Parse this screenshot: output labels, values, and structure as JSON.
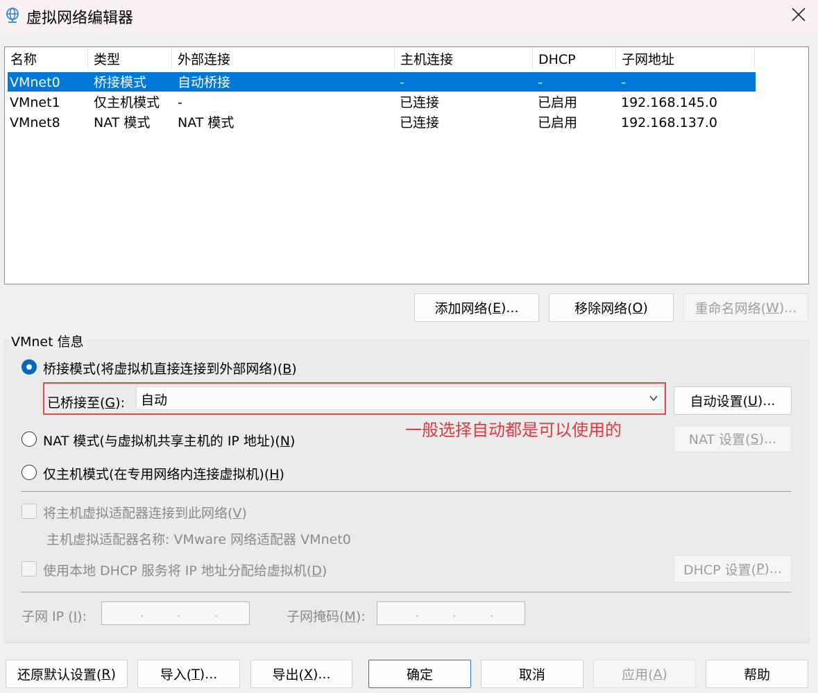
{
  "window": {
    "title": "虚拟网络编辑器"
  },
  "list": {
    "columns": [
      "名称",
      "类型",
      "外部连接",
      "主机连接",
      "DHCP",
      "子网地址"
    ],
    "rows": [
      {
        "name": "VMnet0",
        "type": "桥接模式",
        "external": "自动桥接",
        "host": "-",
        "dhcp": "-",
        "subnet": "-"
      },
      {
        "name": "VMnet1",
        "type": "仅主机模式",
        "external": "-",
        "host": "已连接",
        "dhcp": "已启用",
        "subnet": "192.168.145.0"
      },
      {
        "name": "VMnet8",
        "type": "NAT 模式",
        "external": "NAT 模式",
        "host": "已连接",
        "dhcp": "已启用",
        "subnet": "192.168.137.0"
      }
    ]
  },
  "list_buttons": {
    "add": {
      "pre": "添加网络(",
      "key": "E",
      "post": ")..."
    },
    "remove": {
      "pre": "移除网络(",
      "key": "O",
      "post": ")"
    },
    "rename": {
      "pre": "重命名网络(",
      "key": "W",
      "post": ")..."
    }
  },
  "vmnet_info": {
    "legend": "VMnet 信息",
    "bridged": {
      "pre": "桥接模式(将虚拟机直接连接到外部网络)(",
      "key": "B",
      "post": ")"
    },
    "bridged_to": {
      "pre": "已桥接至(",
      "key": "G",
      "post": "):"
    },
    "bridged_to_value": "自动",
    "auto_settings": {
      "pre": "自动设置(",
      "key": "U",
      "post": ")..."
    },
    "annotation": "一般选择自动都是可以使用的",
    "nat": {
      "pre": "NAT 模式(与虚拟机共享主机的 IP 地址)(",
      "key": "N",
      "post": ")"
    },
    "nat_settings": {
      "pre": "NAT 设置(",
      "key": "S",
      "post": ")..."
    },
    "host_only": {
      "pre": "仅主机模式(在专用网络内连接虚拟机)(",
      "key": "H",
      "post": ")"
    },
    "connect_adapter": {
      "pre": "将主机虚拟适配器连接到此网络(",
      "key": "V",
      "post": ")"
    },
    "adapter_name": "主机虚拟适配器名称: VMware 网络适配器 VMnet0",
    "use_dhcp": {
      "pre": "使用本地 DHCP 服务将 IP 地址分配给虚拟机(",
      "key": "D",
      "post": ")"
    },
    "dhcp_settings": {
      "pre": "DHCP 设置(",
      "key": "P",
      "post": ")..."
    },
    "subnet_ip": {
      "pre": "子网 IP (",
      "key": "I",
      "post": "):"
    },
    "subnet_mask": {
      "pre": "子网掩码(",
      "key": "M",
      "post": "):"
    }
  },
  "footer": {
    "restore": {
      "pre": "还原默认设置(",
      "key": "R",
      "post": ")"
    },
    "import": {
      "pre": "导入(",
      "key": "T",
      "post": ")..."
    },
    "export": {
      "pre": "导出(",
      "key": "X",
      "post": ")..."
    },
    "ok": "确定",
    "cancel": "取消",
    "apply": {
      "pre": "应用(",
      "key": "A",
      "post": ")"
    },
    "help": "帮助"
  },
  "icons": [
    "network-globe-icon",
    "close-icon",
    "chevron-down-icon"
  ],
  "colors": {
    "selection": "#0078d7",
    "annotation": "#e0393e",
    "radio_checked": "#0067c0"
  }
}
